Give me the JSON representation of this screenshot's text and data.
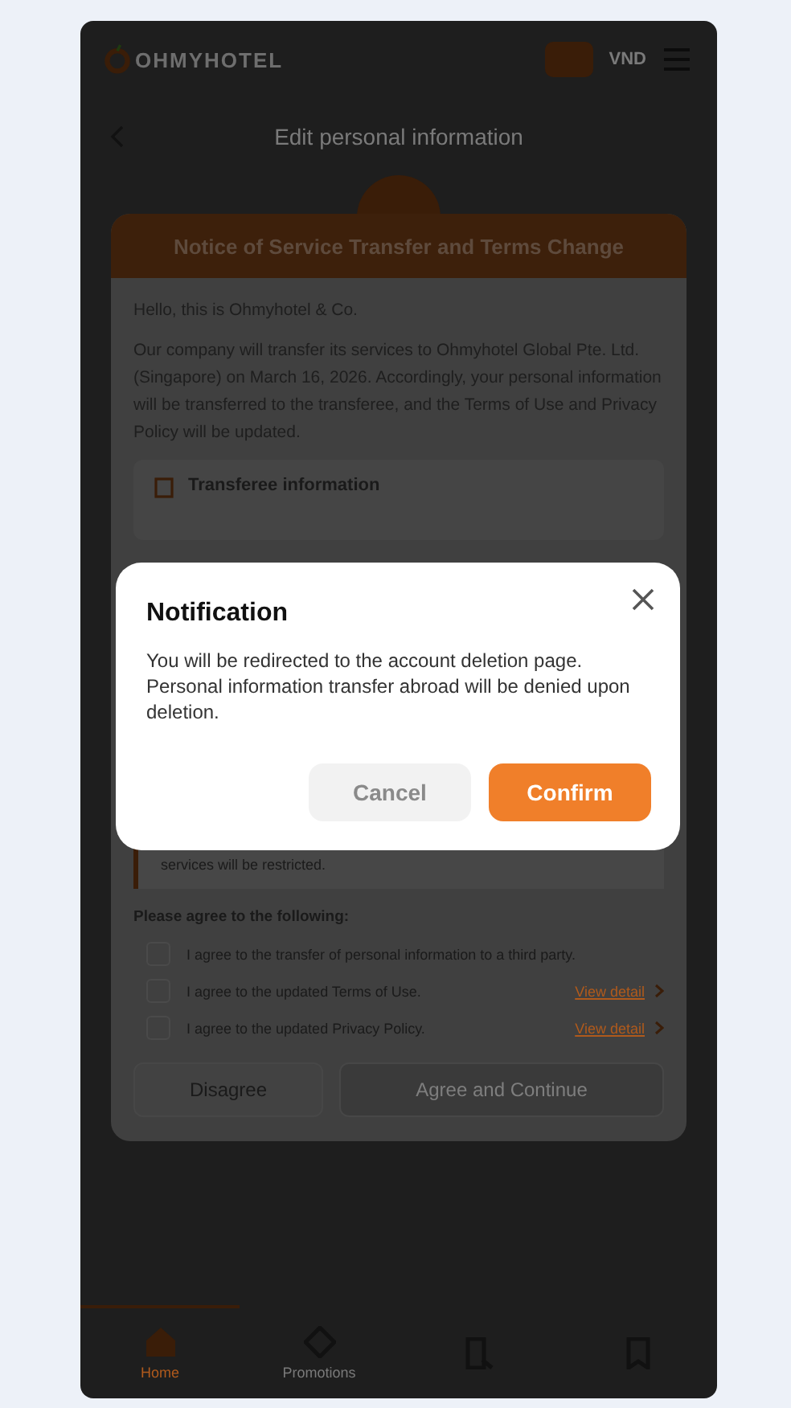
{
  "header": {
    "logo": "OHMYHOTEL",
    "currency": "VND"
  },
  "page": {
    "title": "Edit personal information"
  },
  "notice": {
    "title": "Notice of Service Transfer and Terms Change",
    "greeting": "Hello, this is Ohmyhotel & Co.",
    "message": "Our company will transfer its services to Ohmyhotel Global Pte. Ltd. (Singapore) on March 16, 2026. Accordingly, your personal information will be transferred to the transferee, and the Terms of Use and Privacy Policy will be updated.",
    "transferee_title": "Transferee information",
    "warning_tail": "services will be restricted.",
    "agree_prompt": "Please agree to the following:",
    "agreements": [
      {
        "label": "I agree to the transfer of personal information to a third party.",
        "checked": false
      },
      {
        "label": "I agree to the updated Terms of Use.",
        "checked": false,
        "link": "View detail"
      },
      {
        "label": "I agree to the updated Privacy Policy.",
        "checked": false,
        "link": "View detail"
      }
    ],
    "disagree": "Disagree",
    "agree": "Agree and Continue",
    "agree_disabled": true
  },
  "bottom_nav": [
    {
      "label": "Home",
      "selected": true
    },
    {
      "label": "Promotions",
      "selected": false
    },
    {
      "selected": false
    },
    {
      "selected": false
    }
  ],
  "dialog": {
    "title": "Notification",
    "message": "You will be redirected to the account deletion page.\nPersonal information transfer abroad will be denied upon deletion.",
    "cancel": "Cancel",
    "confirm": "Confirm"
  }
}
